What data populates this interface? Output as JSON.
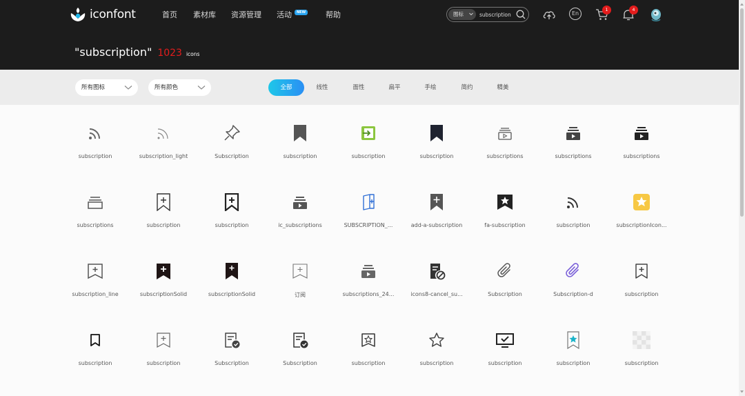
{
  "app": {
    "logo_text": "iconfont"
  },
  "nav": {
    "items": [
      "首页",
      "素材库",
      "资源管理",
      "活动",
      "帮助"
    ],
    "badge": "NEW"
  },
  "search": {
    "type_label": "图标",
    "value": "subscription",
    "placeholder": "subscription"
  },
  "header_icons": {
    "language_label": "En",
    "cart_count": "1",
    "notification_count": "4"
  },
  "title": {
    "query": "\"subscription\"",
    "count": "1023",
    "unit": "icons"
  },
  "filters": {
    "icon_select": "所有图标",
    "color_select": "所有颜色"
  },
  "tabs": {
    "items": [
      "全部",
      "线性",
      "面性",
      "扁平",
      "手绘",
      "简约",
      "精美"
    ],
    "active": "全部"
  },
  "icons": {
    "row1": [
      "subscription",
      "subscription_light",
      "Subscription",
      "subscription",
      "subscription",
      "subscription",
      "subscriptions",
      "subscriptions",
      "subscriptions"
    ],
    "row2": [
      "subscriptions",
      "subscription",
      "subscription",
      "ic_subscriptions",
      "SUBSCRIPTION_...",
      "add-a-subscription",
      "fa-subscription",
      "subscription",
      "subscriptionIcon..."
    ],
    "row3": [
      "subscription_line",
      "subscriptionSolid",
      "subscriptionSolid",
      "订阅",
      "subscriptions_24...",
      "icons8-cancel_su...",
      "Subscription",
      "Subscription-d",
      "subscription"
    ],
    "row4": [
      "subscription",
      "subscription",
      "Subscription",
      "Subscription",
      "subscription",
      "subscription",
      "subscription",
      "subscription",
      "subscription"
    ]
  },
  "colors": {
    "accent_start": "#1fc7e8",
    "accent_end": "#2a8ff4",
    "badge_red": "#e31c1c",
    "header_bg": "#1c1c1c",
    "count_red": "#e31c1c"
  }
}
